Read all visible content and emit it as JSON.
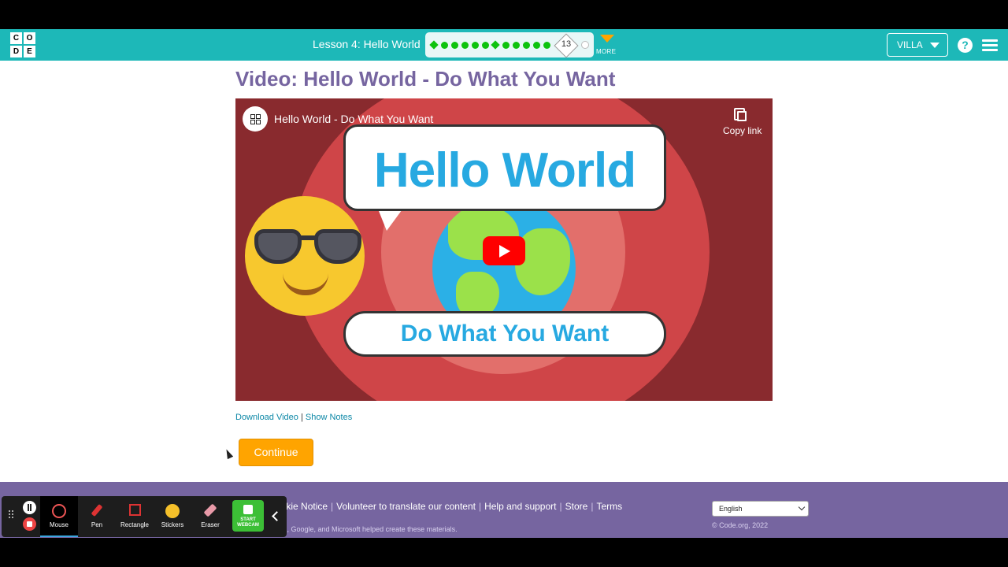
{
  "header": {
    "logo_letters": [
      "C",
      "O",
      "D",
      "E"
    ],
    "lesson_title": "Lesson 4: Hello World",
    "current_level": "13",
    "more_label": "MORE",
    "user_label": "VILLA",
    "help_symbol": "?"
  },
  "main": {
    "page_title": "Video: Hello World - Do What You Want",
    "video": {
      "youtube_title": "Hello World - Do What You Want",
      "copy_link_label": "Copy link",
      "thumbnail_top_text": "Hello World",
      "thumbnail_bottom_text": "Do What You Want"
    },
    "download_video_label": "Download Video",
    "separator": "|",
    "show_notes_label": "Show Notes",
    "continue_label": "Continue"
  },
  "footer": {
    "links": [
      "ookie Notice",
      "Volunteer to translate our content",
      "Help and support",
      "Store",
      "Terms"
    ],
    "credit": "zon, Google, and Microsoft helped create these materials.",
    "language": "English",
    "copyright": "© Code.org, 2022"
  },
  "recorder": {
    "tools": [
      "Mouse",
      "Pen",
      "Rectangle",
      "Stickers",
      "Eraser"
    ],
    "webcam_label_1": "START",
    "webcam_label_2": "WEBCAM"
  },
  "colors": {
    "header_bg": "#1db8b8",
    "title_purple": "#7665a0",
    "continue_orange": "#ffa400",
    "progress_green": "#0ec30e",
    "link_teal": "#0b87a6",
    "footer_bg": "#7665a0"
  }
}
